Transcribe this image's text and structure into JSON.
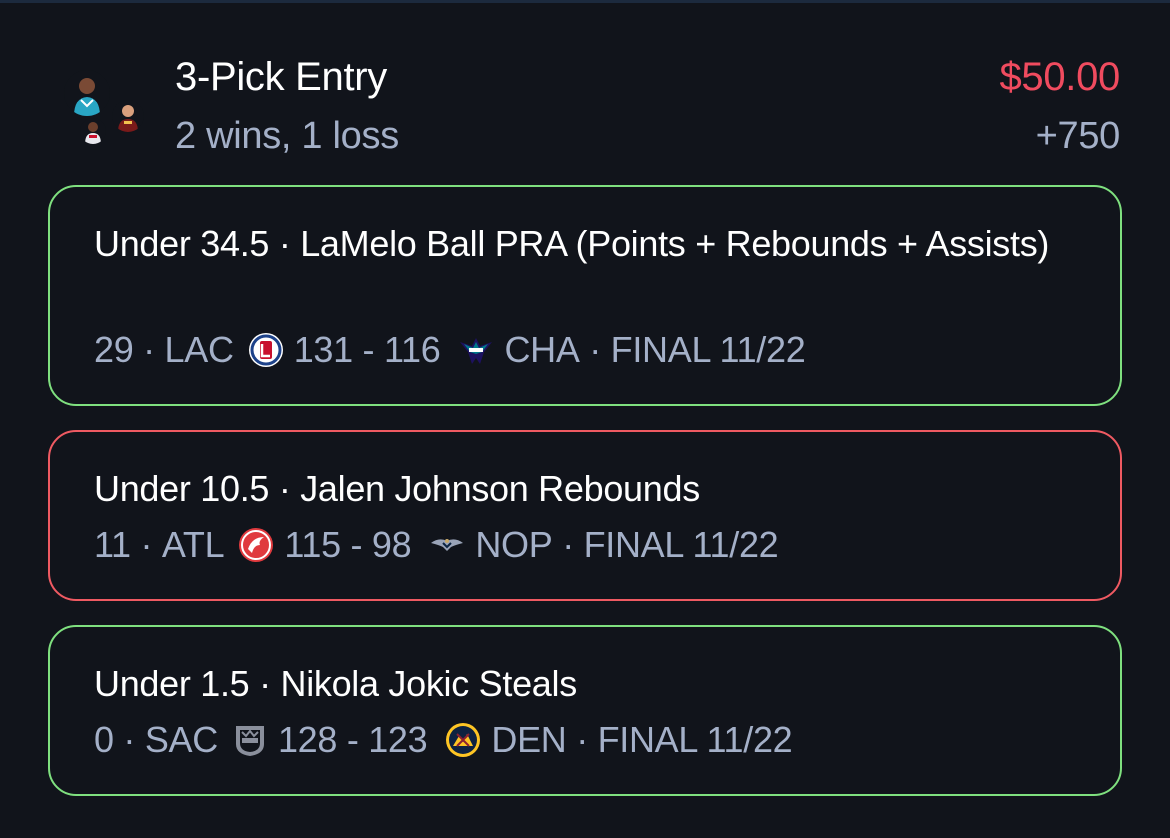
{
  "entry": {
    "title": "3-Pick Entry",
    "record": "2 wins, 1 loss",
    "amount": "$50.00",
    "odds": "+750"
  },
  "colors": {
    "background": "#11141b",
    "win_border": "#7fe07f",
    "loss_border": "#ef5a62",
    "amount": "#f04b5f",
    "secondary_text": "#a4b0c8"
  },
  "picks": [
    {
      "status": "win",
      "line": "Under 34.5 · LaMelo Ball PRA (Points + Rebounds + Assists)",
      "actual": "29 ·",
      "away_team": "LAC",
      "away_logo": "clippers-logo-icon",
      "score": "131 - 116",
      "home_logo": "hornets-logo-icon",
      "home_team": "CHA",
      "game_status": "· FINAL 11/22"
    },
    {
      "status": "loss",
      "line": "Under 10.5 · Jalen Johnson Rebounds",
      "actual": "11 ·",
      "away_team": "ATL",
      "away_logo": "hawks-logo-icon",
      "score": "115 - 98",
      "home_logo": "pelicans-logo-icon",
      "home_team": "NOP",
      "game_status": "· FINAL 11/22"
    },
    {
      "status": "win",
      "line": "Under 1.5 · Nikola Jokic Steals",
      "actual": "0 ·",
      "away_team": "SAC",
      "away_logo": "kings-logo-icon",
      "score": "128 - 123",
      "home_logo": "nuggets-logo-icon",
      "home_team": "DEN",
      "game_status": "· FINAL 11/22"
    }
  ]
}
